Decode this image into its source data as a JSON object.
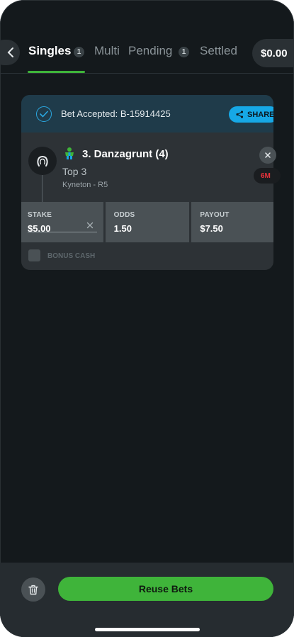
{
  "tabs": [
    {
      "label": "Singles",
      "badge": "1",
      "active": true
    },
    {
      "label": "Multi",
      "badge": ""
    },
    {
      "label": "Pending",
      "badge": "1"
    },
    {
      "label": "Settled",
      "badge": ""
    }
  ],
  "balance": "$0.00",
  "bet": {
    "accepted_text": "Bet Accepted: B-15914425",
    "share_label": "SHARE",
    "runner": "3. Danzagrunt (4)",
    "bet_type": "Top 3",
    "race": "Kyneton - R5",
    "time_badge": "6M",
    "stake_label": "STAKE",
    "stake_value": "$5.00",
    "odds_label": "ODDS",
    "odds_value": "1.50",
    "payout_label": "PAYOUT",
    "payout_value": "$7.50",
    "bonus_label": "BONUS CASH"
  },
  "footer": {
    "reuse_label": "Reuse Bets"
  },
  "colors": {
    "accent_green": "#3fb43a",
    "share_blue": "#16a8e6",
    "time_red": "#e5323b"
  }
}
